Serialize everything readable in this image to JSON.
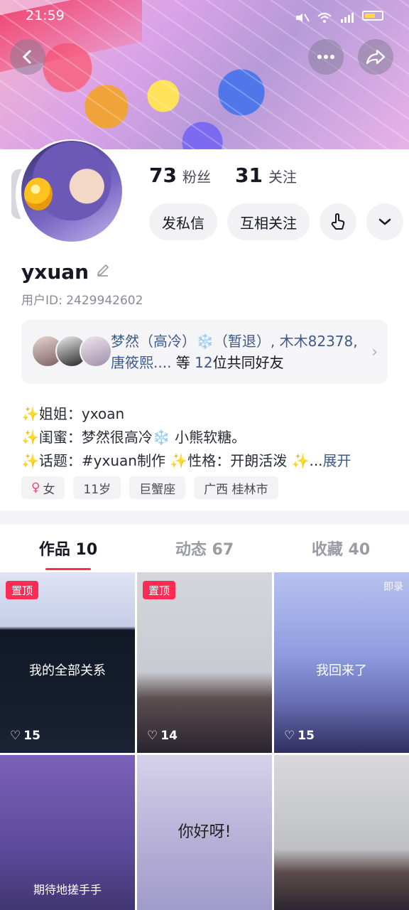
{
  "status_bar": {
    "time": "21:59"
  },
  "header": {
    "back_icon": "chevron-left-icon",
    "more_icon": "more-horizontal-icon",
    "share_icon": "share-icon"
  },
  "profile": {
    "followers_count": "73",
    "followers_label": "粉丝",
    "following_count": "31",
    "following_label": "关注",
    "message_button": "发私信",
    "follow_button": "互相关注",
    "username": "yxuan",
    "user_id": "用户ID: 2429942602"
  },
  "mutual_friends": {
    "names": "梦然（高冷）❄️（暂退）, 木木82378, 唐筱熙....",
    "suffix_pre": " 等 ",
    "count": "12",
    "suffix_post": "位共同好友"
  },
  "bio": {
    "line1": "✨姐姐：yxoan",
    "line2": "✨闺蜜：梦然很高冷❄️ 小熊软糖。",
    "line3": "✨话题：#yxuan制作 ✨性格：开朗活泼 ✨...",
    "more": "展开"
  },
  "tags": {
    "gender": "女",
    "age": "11岁",
    "zodiac": "巨蟹座",
    "location": "广西 桂林市"
  },
  "tabs": [
    {
      "label": "作品 10"
    },
    {
      "label": "动态 67"
    },
    {
      "label": "收藏 40"
    }
  ],
  "grid": {
    "pinned_label": "置顶",
    "items": [
      {
        "likes": "15",
        "caption": "我的全部关系"
      },
      {
        "likes": "14"
      },
      {
        "likes": "15",
        "caption": "我回来了",
        "watermark": "即录"
      },
      {
        "caption": "期待地搓手手"
      },
      {
        "caption": "你好呀!"
      },
      {}
    ]
  }
}
